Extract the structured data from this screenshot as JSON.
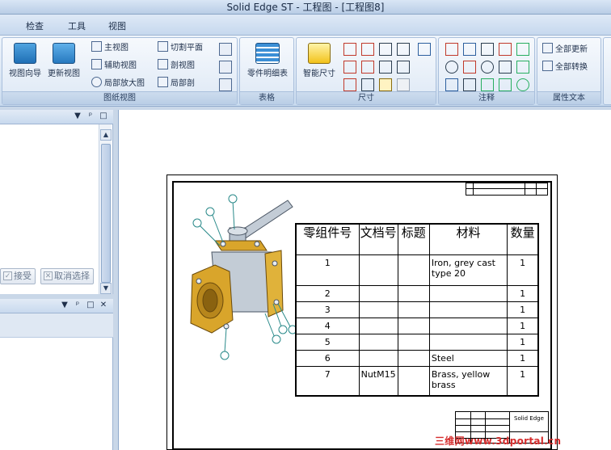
{
  "window": {
    "title": "Solid Edge ST - 工程图 - [工程图8]"
  },
  "menu": {
    "tabs": [
      "检查",
      "工具",
      "视图"
    ]
  },
  "ribbon": {
    "groups": {
      "drawing_views": {
        "label": "图纸视图",
        "big": [
          "视图向导",
          "更新视图"
        ],
        "small": [
          "主视图",
          "辅助视图",
          "局部放大图",
          "切割平面",
          "剖视图",
          "局部剖"
        ]
      },
      "tables": {
        "label": "表格",
        "big": [
          "零件明细表"
        ]
      },
      "dimensions": {
        "label": "尺寸",
        "big": [
          "智能尺寸"
        ]
      },
      "annotations": {
        "label": "注释"
      },
      "property_text": {
        "label": "属性文本",
        "small": [
          "全部更新",
          "全部转换"
        ]
      }
    }
  },
  "panel": {
    "accept": "接受",
    "cancel": "取消选择"
  },
  "parts_list": {
    "headers": [
      "零组件号",
      "文档号",
      "标题",
      "材料",
      "数量"
    ],
    "rows": [
      [
        "1",
        "",
        "",
        "Iron, grey cast type 20",
        "1"
      ],
      [
        "2",
        "",
        "",
        "",
        "1"
      ],
      [
        "3",
        "",
        "",
        "",
        "1"
      ],
      [
        "4",
        "",
        "",
        "",
        "1"
      ],
      [
        "5",
        "",
        "",
        "",
        "1"
      ],
      [
        "6",
        "",
        "",
        "Steel",
        "1"
      ],
      [
        "7",
        "NutM15",
        "",
        "Brass, yellow brass",
        "1"
      ]
    ]
  },
  "title_block": {
    "company": "Solid Edge"
  },
  "watermark": "三维网www.3dportal.cn",
  "colors": {
    "brass": "#d9a52b",
    "steel": "#b9c4d0",
    "ribbon": "#d7e4f3",
    "balloon": "#2a8a8a"
  }
}
